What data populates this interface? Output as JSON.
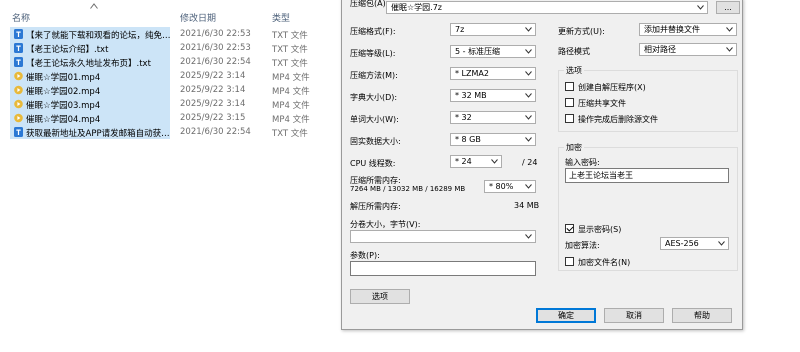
{
  "explorer": {
    "headers": {
      "name": "名称",
      "date": "修改日期",
      "type": "类型"
    },
    "files": [
      {
        "name": "【来了就能下载和观看的论坛，纯免费！...",
        "date": "2021/6/30 22:53",
        "type": "TXT 文件",
        "kind": "txt"
      },
      {
        "name": "【老王论坛介绍】.txt",
        "date": "2021/6/30 22:53",
        "type": "TXT 文件",
        "kind": "txt"
      },
      {
        "name": "【老王论坛永久地址发布页】.txt",
        "date": "2021/6/30 22:54",
        "type": "TXT 文件",
        "kind": "txt"
      },
      {
        "name": "催眠☆学园01.mp4",
        "date": "2025/9/22 3:14",
        "type": "MP4 文件",
        "kind": "mp4"
      },
      {
        "name": "催眠☆学园02.mp4",
        "date": "2025/9/22 3:14",
        "type": "MP4 文件",
        "kind": "mp4"
      },
      {
        "name": "催眠☆学园03.mp4",
        "date": "2025/9/22 3:14",
        "type": "MP4 文件",
        "kind": "mp4"
      },
      {
        "name": "催眠☆学园04.mp4",
        "date": "2025/9/22 3:15",
        "type": "MP4 文件",
        "kind": "mp4"
      },
      {
        "name": "获取最新地址及APP请发邮箱自动获取.txt",
        "date": "2021/6/30 22:54",
        "type": "TXT 文件",
        "kind": "txt"
      }
    ]
  },
  "dialog": {
    "archive_label": "压缩包(A):",
    "archive_value": "催眠☆学园.7z",
    "browse_label": "...",
    "format_label": "压缩格式(F):",
    "format_value": "7z",
    "level_label": "压缩等级(L):",
    "level_value": "5 - 标准压缩",
    "method_label": "压缩方法(M):",
    "method_value": "* LZMA2",
    "dict_label": "字典大小(D):",
    "dict_value": "* 32 MB",
    "word_label": "单词大小(W):",
    "word_value": "* 32",
    "solid_label": "固实数据大小:",
    "solid_value": "* 8 GB",
    "cpu_label": "CPU 线程数:",
    "cpu_value": "* 24",
    "cpu_max": "/ 24",
    "mem_label": "压缩所需内存:",
    "mem_detail": "7264 MB / 13032 MB / 16289 MB",
    "mem_value": "* 80%",
    "demem_label": "解压所需内存:",
    "demem_value": "34 MB",
    "split_label": "分卷大小，字节(V):",
    "split_value": "",
    "params_label": "参数(P):",
    "params_value": "",
    "options_button": "选项",
    "update_label": "更新方式(U):",
    "update_value": "添加并替换文件",
    "path_label": "路径模式",
    "path_value": "相对路径",
    "opts_title": "选项",
    "opt_sfx": "创建自解压程序(X)",
    "opt_shared": "压缩共享文件",
    "opt_delete": "操作完成后删除源文件",
    "enc_title": "加密",
    "pwd_label": "输入密码:",
    "pwd_value": "上老王论坛当老王",
    "show_pwd": "显示密码(S)",
    "enc_method_label": "加密算法:",
    "enc_method_value": "AES-256",
    "enc_names": "加密文件名(N)",
    "ok": "确定",
    "cancel": "取消",
    "help": "帮助"
  },
  "colors": {
    "selection": "#cce4f7",
    "highlight_row": "#d9d9d9",
    "txt_icon": "#2b78d4",
    "mp4_icon": "#e8b93a",
    "accent": "#0078d7"
  }
}
